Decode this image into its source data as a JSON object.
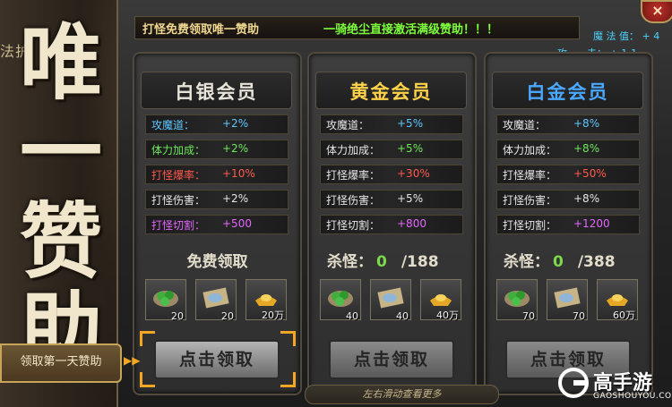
{
  "window": {
    "left_header_text": "法护",
    "title_chars": [
      "唯",
      "一",
      "赞",
      "助"
    ],
    "banner_text_1": "打怪免费领取唯一赞助",
    "banner_text_2": "一骑绝尘直接激活满级赞助！！！",
    "close_label": "×",
    "stat_magic": "魔 法 值： + 4",
    "stat_attack": "攻　　击： + 1-1"
  },
  "side_tab": {
    "label": "领取第一天赞助"
  },
  "scroll_hint": "左右滑动查看更多",
  "colors": {
    "gold": "#f0d890",
    "green": "#7dff3d",
    "blue_stat": "#4cd3ff",
    "red_stat": "#ff5a4e",
    "purple_stat": "#e566ff",
    "orange_accent": "#f2a623"
  },
  "cards": [
    {
      "title": "白银会员",
      "title_color": "#e8e4da",
      "stats": [
        {
          "label": "攻魔道：",
          "value": "+2%",
          "label_color": "#5ec8ff",
          "value_color": "#5ec8ff"
        },
        {
          "label": "体力加成：",
          "value": "+2%",
          "label_color": "#6fe85a",
          "value_color": "#6fe85a"
        },
        {
          "label": "打怪爆率：",
          "value": "+10%",
          "label_color": "#ff5a4e",
          "value_color": "#ff5a4e"
        },
        {
          "label": "打怪伤害：",
          "value": "+2%",
          "label_color": "#e6e6e6",
          "value_color": "#e6e6e6"
        },
        {
          "label": "打怪切割：",
          "value": "+500",
          "label_color": "#e566ff",
          "value_color": "#e566ff"
        }
      ],
      "claim_text": "免费领取",
      "items": [
        {
          "icon": "green-pills-icon",
          "qty": "20"
        },
        {
          "icon": "scroll-icon",
          "qty": "20"
        },
        {
          "icon": "gold-ingot-icon",
          "qty": "20万"
        }
      ],
      "button_label": "点击领取"
    },
    {
      "title": "黄金会员",
      "title_color": "#ffd24a",
      "stats": [
        {
          "label": "攻魔道：",
          "value": "+5%",
          "label_color": "#e6e6e6",
          "value_color": "#5ec8ff"
        },
        {
          "label": "体力加成：",
          "value": "+5%",
          "label_color": "#e6e6e6",
          "value_color": "#6fe85a"
        },
        {
          "label": "打怪爆率：",
          "value": "+30%",
          "label_color": "#e6e6e6",
          "value_color": "#ff5a4e"
        },
        {
          "label": "打怪伤害：",
          "value": "+5%",
          "label_color": "#e6e6e6",
          "value_color": "#e6e6e6"
        },
        {
          "label": "打怪切割：",
          "value": "+800",
          "label_color": "#e6e6e6",
          "value_color": "#e566ff"
        }
      ],
      "kill_label": "杀怪：",
      "kill_current": "0",
      "kill_total": "/188",
      "items": [
        {
          "icon": "green-pills-icon",
          "qty": "40"
        },
        {
          "icon": "scroll-icon",
          "qty": "40"
        },
        {
          "icon": "gold-ingot-icon",
          "qty": "40万"
        }
      ],
      "button_label": "点击领取"
    },
    {
      "title": "白金会员",
      "title_color": "#4aa8ff",
      "stats": [
        {
          "label": "攻魔道：",
          "value": "+8%",
          "label_color": "#e6e6e6",
          "value_color": "#5ec8ff"
        },
        {
          "label": "体力加成：",
          "value": "+8%",
          "label_color": "#e6e6e6",
          "value_color": "#6fe85a"
        },
        {
          "label": "打怪爆率：",
          "value": "+50%",
          "label_color": "#e6e6e6",
          "value_color": "#ff5a4e"
        },
        {
          "label": "打怪伤害：",
          "value": "+8%",
          "label_color": "#e6e6e6",
          "value_color": "#e6e6e6"
        },
        {
          "label": "打怪切割：",
          "value": "+1200",
          "label_color": "#e6e6e6",
          "value_color": "#e566ff"
        }
      ],
      "kill_label": "杀怪：",
      "kill_current": "0",
      "kill_total": "/388",
      "items": [
        {
          "icon": "green-pills-icon",
          "qty": "70"
        },
        {
          "icon": "scroll-icon",
          "qty": "70"
        },
        {
          "icon": "gold-ingot-icon",
          "qty": "60万"
        }
      ],
      "button_label": "点击领取"
    }
  ],
  "watermark": {
    "name": "高手游",
    "url": "GAOSHOUYOU.COM"
  }
}
